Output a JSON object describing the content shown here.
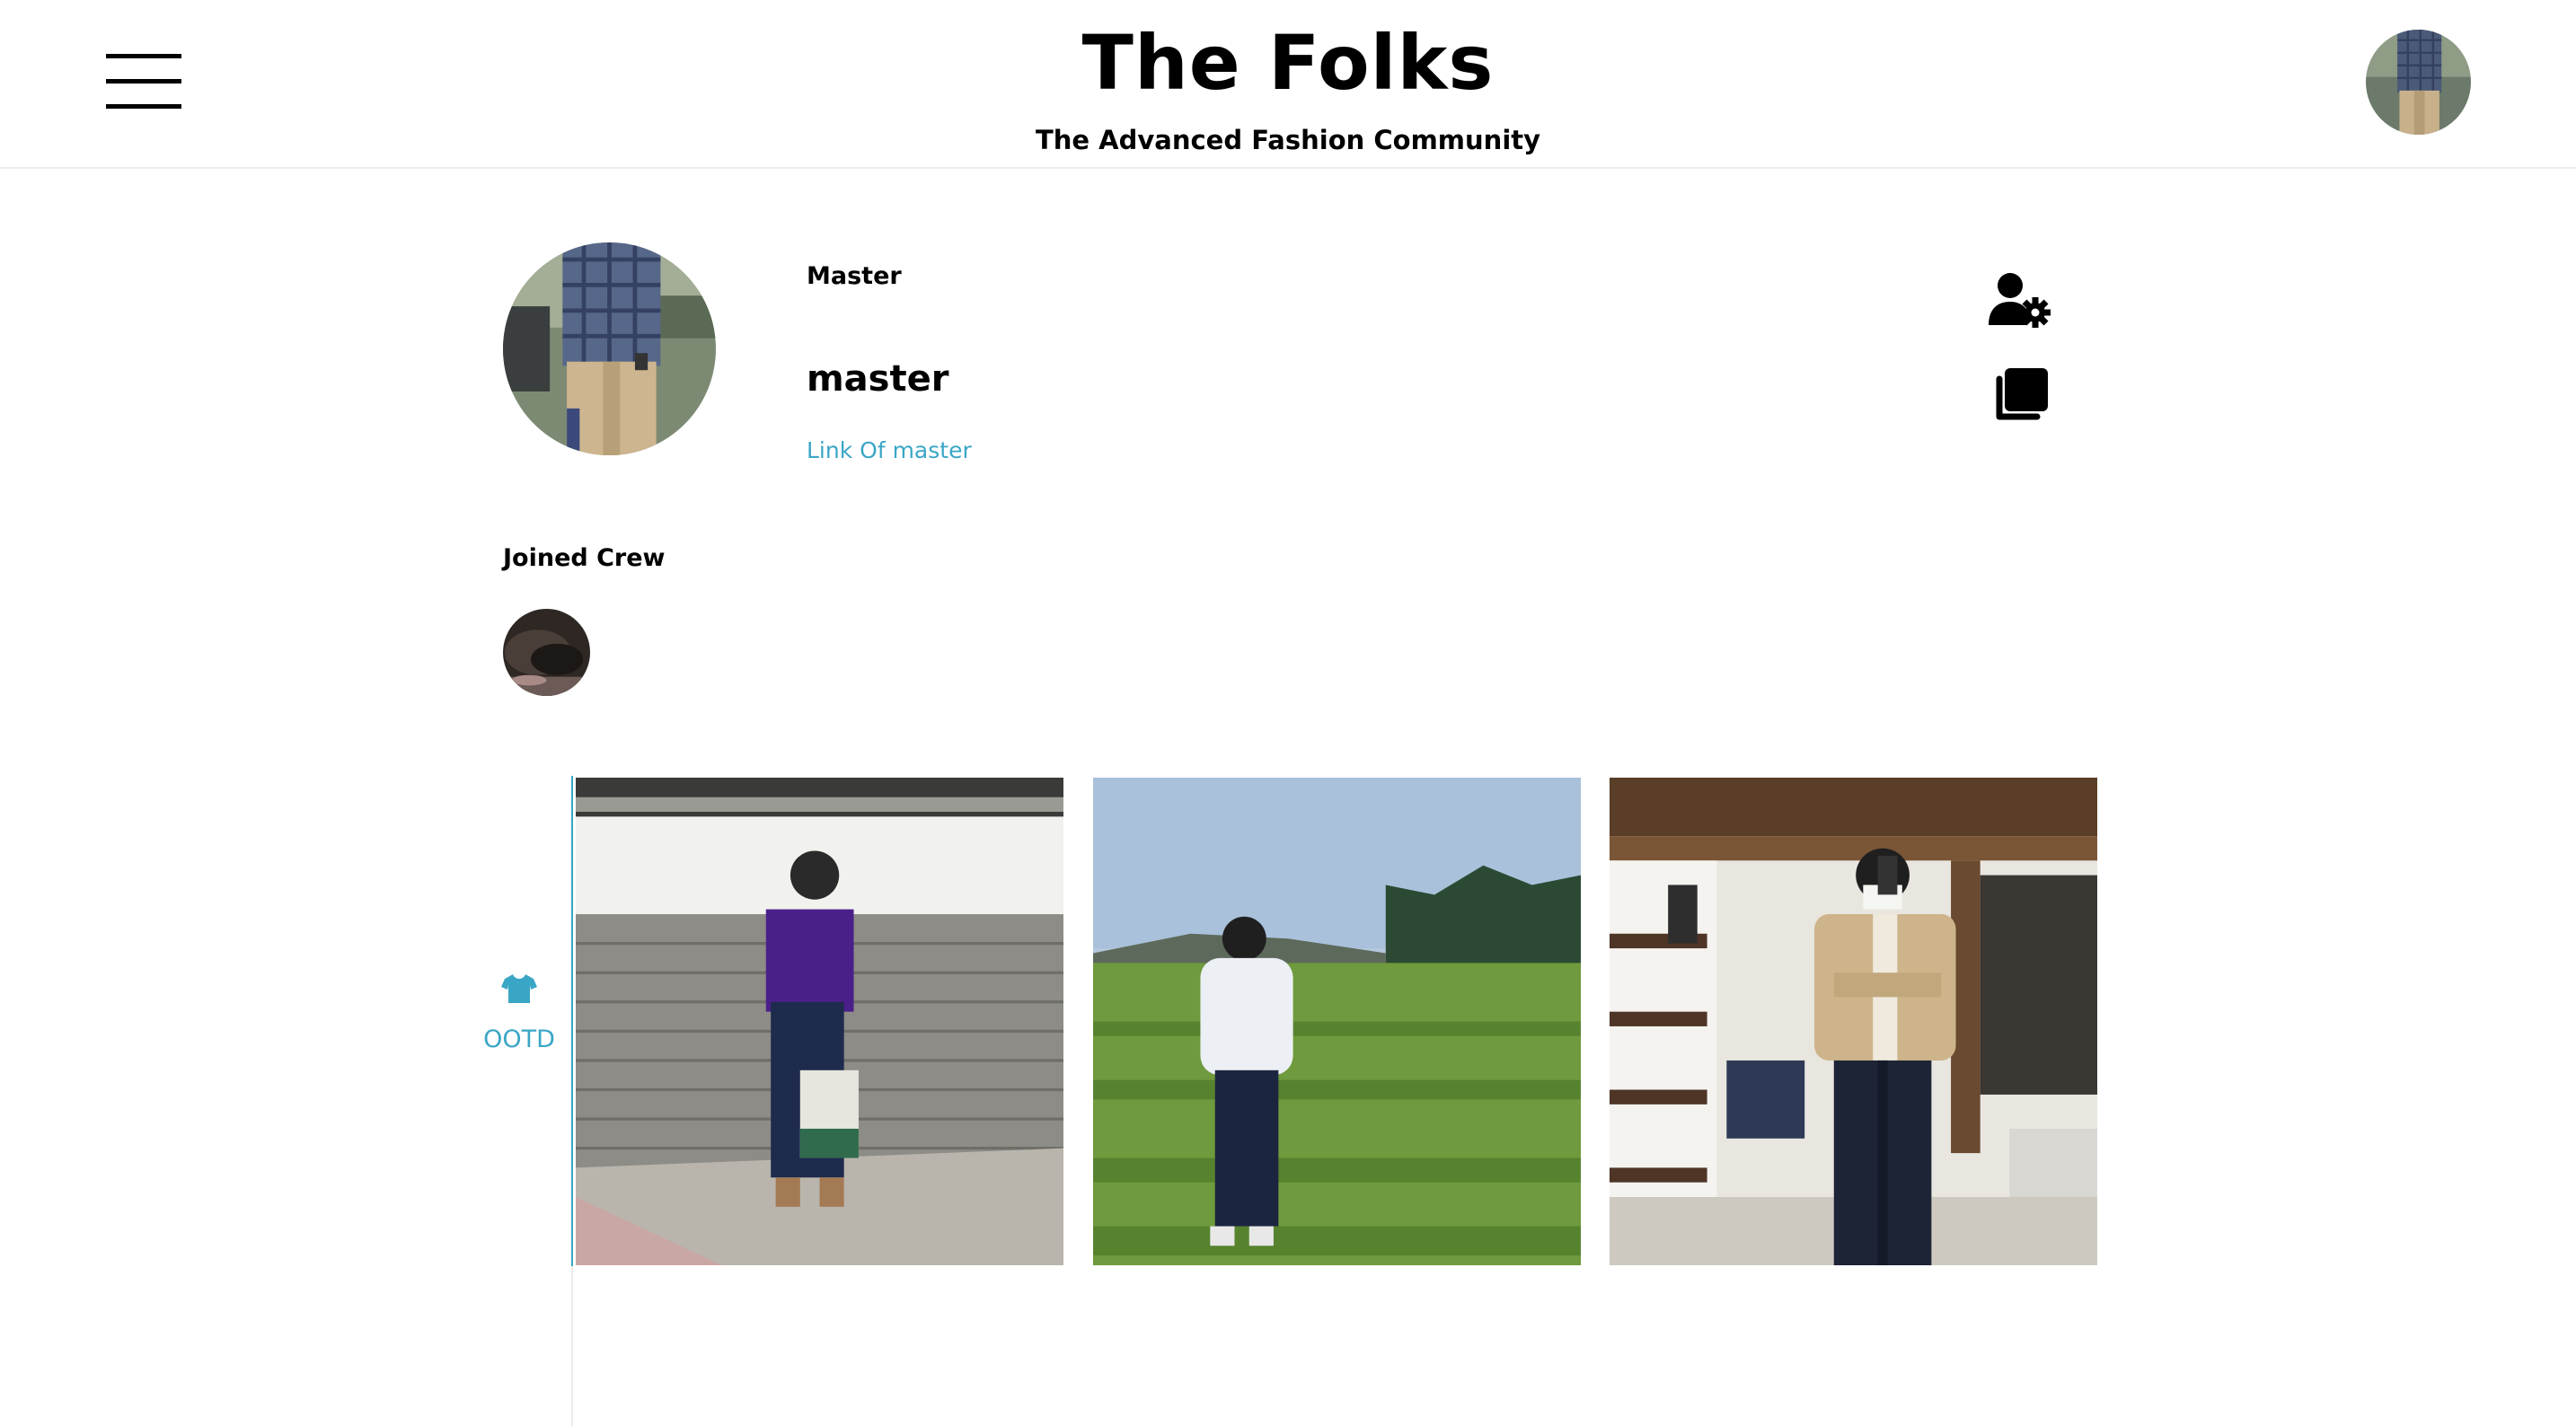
{
  "header": {
    "menu_icon": "hamburger-menu-icon",
    "title": "The Folks",
    "subtitle": "The Advanced Fashion Community",
    "avatar_alt": "user-avatar"
  },
  "profile": {
    "role": "Master",
    "name": "master",
    "link_text": "Link Of master",
    "settings_icon": "user-gear-icon",
    "copy_icon": "copy-icon"
  },
  "crew": {
    "heading": "Joined Crew"
  },
  "tabs": [
    {
      "label": "OOTD",
      "icon": "tshirt-icon",
      "active": true
    }
  ],
  "posts": [
    {
      "description": "man in purple polo walking past brick wall with tote bag"
    },
    {
      "description": "man in white sweatshirt walking through green field"
    },
    {
      "description": "man in beige cardigan taking mirror selfie in shoe shop"
    }
  ],
  "colors": {
    "accent": "#3aa6c5",
    "text": "#000000",
    "divider": "#ececec",
    "background": "#ffffff"
  }
}
